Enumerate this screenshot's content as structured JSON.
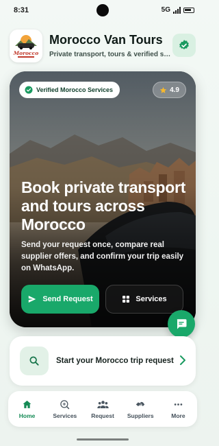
{
  "status_bar": {
    "time": "8:31",
    "network": "5G"
  },
  "header": {
    "title": "Morocco Van Tours",
    "subtitle": "Private transport, tours & verified suppliers",
    "logo_text": "Morocco"
  },
  "hero": {
    "verified_badge": "Verified Morocco Services",
    "rating": "4.9",
    "title": "Book private transport and tours across Morocco",
    "description": "Send your request once, compare real supplier offers, and confirm your trip easily on WhatsApp.",
    "primary_button": "Send Request",
    "secondary_button": "Services"
  },
  "request_card": {
    "text": "Start your Morocco trip request"
  },
  "nav": {
    "items": [
      {
        "label": "Home",
        "icon": "home-icon",
        "active": true
      },
      {
        "label": "Services",
        "icon": "services-icon",
        "active": false
      },
      {
        "label": "Request",
        "icon": "people-icon",
        "active": false
      },
      {
        "label": "Suppliers",
        "icon": "handshake-icon",
        "active": false
      },
      {
        "label": "More",
        "icon": "more-icon",
        "active": false
      }
    ]
  },
  "colors": {
    "accent": "#19a86a",
    "accent_dark": "#148a55",
    "accent_light": "#d9f0e2"
  }
}
